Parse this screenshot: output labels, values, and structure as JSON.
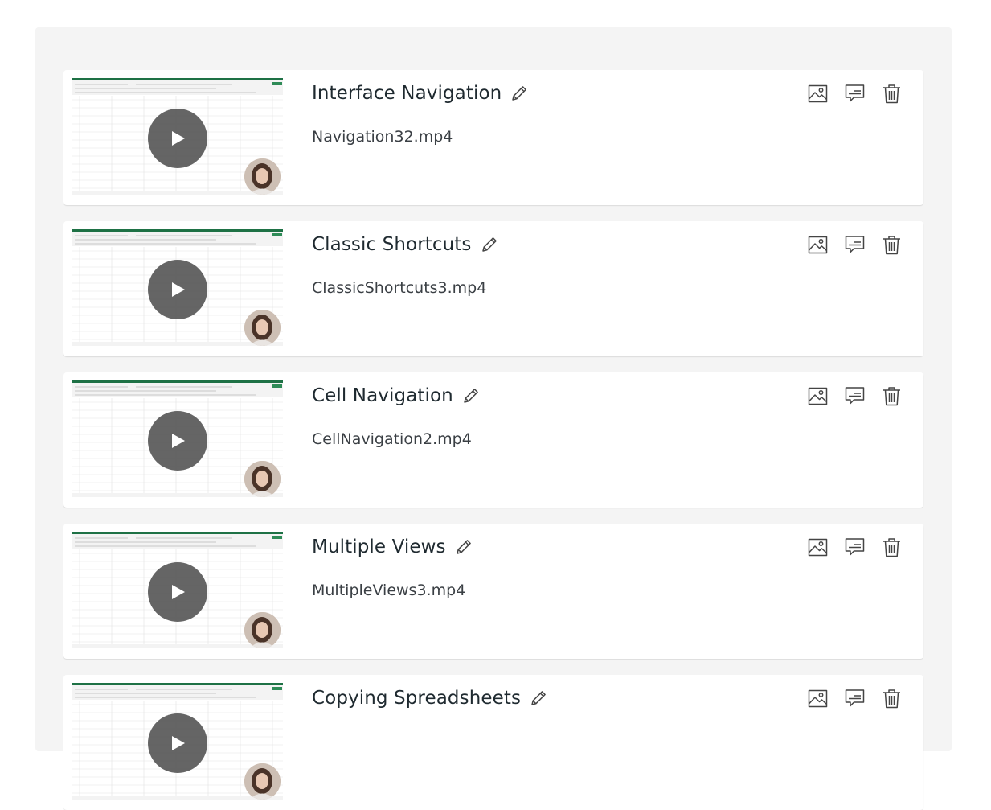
{
  "videos": [
    {
      "title": "Interface Navigation",
      "filename": "Navigation32.mp4"
    },
    {
      "title": "Classic Shortcuts",
      "filename": "ClassicShortcuts3.mp4"
    },
    {
      "title": "Cell Navigation",
      "filename": "CellNavigation2.mp4"
    },
    {
      "title": "Multiple Views",
      "filename": "MultipleViews3.mp4"
    },
    {
      "title": "Copying Spreadsheets",
      "filename": ""
    }
  ],
  "icons": {
    "edit": "pencil-icon",
    "thumbnail": "image-icon",
    "captions": "captions-icon",
    "delete": "trash-icon",
    "play": "play-icon"
  },
  "colors": {
    "panel": "#f4f4f4",
    "card": "#ffffff",
    "title": "#1f2a30",
    "play_overlay": "#505050"
  }
}
